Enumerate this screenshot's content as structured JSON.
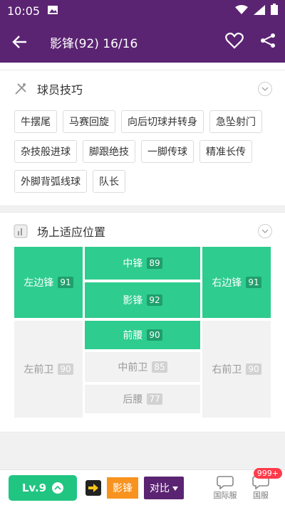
{
  "status": {
    "time": "10:05"
  },
  "header": {
    "title": "影锋(92)  16/16"
  },
  "skills": {
    "title": "球员技巧",
    "tags": [
      "牛摆尾",
      "马赛回旋",
      "向后切球并转身",
      "急坠射门",
      "杂技般进球",
      "脚跟绝技",
      "一脚传球",
      "精准长传",
      "外脚背弧线球",
      "队长"
    ]
  },
  "positions": {
    "title": "场上适应位置",
    "LW": {
      "label": "左边锋",
      "rating": "91",
      "active": true
    },
    "ST": {
      "label": "中锋",
      "rating": "89",
      "active": true
    },
    "CF": {
      "label": "影锋",
      "rating": "92",
      "active": true
    },
    "RW": {
      "label": "右边锋",
      "rating": "91",
      "active": true
    },
    "CAM": {
      "label": "前腰",
      "rating": "90",
      "active": true
    },
    "LM": {
      "label": "左前卫",
      "rating": "90",
      "active": false
    },
    "CM": {
      "label": "中前卫",
      "rating": "85",
      "active": false
    },
    "RM": {
      "label": "右前卫",
      "rating": "90",
      "active": false
    },
    "CDM": {
      "label": "后腰",
      "rating": "77",
      "active": false
    }
  },
  "bottom": {
    "level": "Lv.9",
    "position": "影锋",
    "compare": "对比",
    "server_intl": "国际服",
    "server_cn": "国服",
    "badge": "999+"
  },
  "colors": {
    "brand": "#5b2472",
    "active": "#2ecc8f",
    "accent": "#f7931e"
  }
}
